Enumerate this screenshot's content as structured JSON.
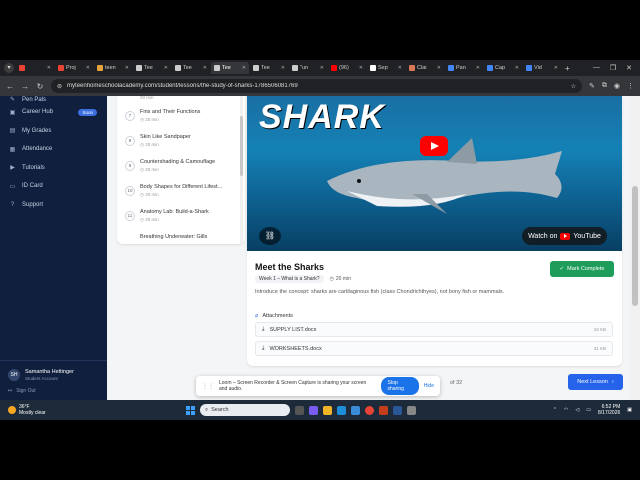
{
  "browser": {
    "tabs": [
      {
        "label": "",
        "color": "#ea4335"
      },
      {
        "label": "Proj",
        "color": "#ea4335"
      },
      {
        "label": "teen",
        "color": "#e8a33d"
      },
      {
        "label": "Tee",
        "color": "#cccccc"
      },
      {
        "label": "Tee",
        "color": "#cccccc"
      },
      {
        "label": "Tee",
        "color": "#cccccc",
        "active": true
      },
      {
        "label": "Tee",
        "color": "#cccccc"
      },
      {
        "label": "\"un",
        "color": "#cccccc"
      },
      {
        "label": "(96)",
        "color": "#ff0000"
      },
      {
        "label": "Sep",
        "color": "#ffffff"
      },
      {
        "label": "Clai",
        "color": "#d97757"
      },
      {
        "label": "Pan",
        "color": "#4285f4"
      },
      {
        "label": "Cap",
        "color": "#4285f4"
      },
      {
        "label": "Vid",
        "color": "#4285f4"
      }
    ],
    "url": "myteenhomeschoolacademy.com/student/lessons/the-study-of-sharks-1786506081769"
  },
  "sidebar": {
    "items": [
      {
        "label": "Pen Pals",
        "icon": "pen-icon"
      },
      {
        "label": "Career Hub",
        "icon": "briefcase-icon",
        "badge": "Soon"
      },
      {
        "label": "My Grades",
        "icon": "grades-icon"
      },
      {
        "label": "Attendance",
        "icon": "calendar-icon"
      },
      {
        "label": "Tutorials",
        "icon": "tutorials-icon"
      },
      {
        "label": "ID Card",
        "icon": "id-card-icon"
      },
      {
        "label": "Support",
        "icon": "support-icon"
      }
    ],
    "user": {
      "initials": "SH",
      "name": "Samantha Hettinger",
      "role": "Student Account"
    },
    "sign_out": "Sign Out"
  },
  "lessons": {
    "top_duration": "20 min",
    "items": [
      {
        "num": "7",
        "title": "Fins and Their Functions",
        "duration": "20 min"
      },
      {
        "num": "8",
        "title": "Skin Like Sandpaper",
        "duration": "20 min"
      },
      {
        "num": "9",
        "title": "Countershading & Camouflage",
        "duration": "20 min"
      },
      {
        "num": "10",
        "title": "Body Shapes for Different Lifest...",
        "duration": "20 min"
      },
      {
        "num": "11",
        "title": "Anatomy Lab: Build-a-Shark",
        "duration": "20 min"
      },
      {
        "num": "",
        "title": "Breathing Underwater: Gills",
        "duration": ""
      }
    ]
  },
  "video": {
    "overlay_title": "SHARK",
    "watch_on": "Watch on",
    "youtube": "YouTube"
  },
  "lesson": {
    "title": "Meet the Sharks",
    "week": "Week 1 – What is a Shark?",
    "duration": "20 min",
    "mark_complete": "Mark Complete",
    "description": "Introduce the concept: sharks are cartilaginous fish (class Chondrichthyes), not bony fish or mammals.",
    "attachments_label": "Attachments",
    "attachments": [
      {
        "name": "SUPPLY LIST.docx",
        "size": "19 KB"
      },
      {
        "name": "WORKSHEETS.docx",
        "size": "31 KB"
      }
    ],
    "counter": "of 32",
    "next": "Next Lesson"
  },
  "loom": {
    "message": "Loom – Screen Recorder & Screen Capture is sharing your screen and audio.",
    "stop": "Stop sharing",
    "hide": "Hide"
  },
  "taskbar": {
    "temp": "36°F",
    "weather": "Mostly clear",
    "search": "Search",
    "time": "6:52 PM",
    "date": "8/17/2026"
  }
}
